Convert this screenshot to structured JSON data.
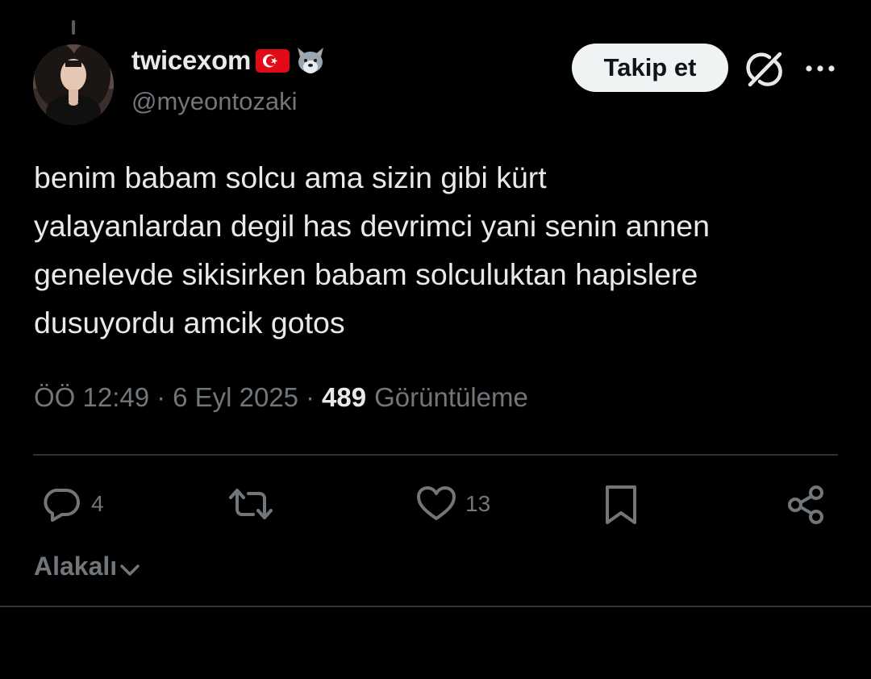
{
  "author": {
    "display_name": "twicexom",
    "handle": "@myeontozaki",
    "badges": [
      "turkey-flag-emoji",
      "wolf-emoji"
    ]
  },
  "header": {
    "follow_label": "Takip et",
    "grok_icon": "grok-icon",
    "more_icon": "more-icon"
  },
  "tweet": {
    "text": "benim babam solcu ama sizin gibi kürt\nyalayanlardan degil has devrimci yani senin annen\ngenelevde sikisirken babam solculuktan hapislere\ndusuyordu amcik gotos",
    "time": "ÖÖ 12:49",
    "date": "6 Eyl 2025",
    "separator": "·",
    "views_count": "489",
    "views_label": "Görüntüleme"
  },
  "actions": {
    "reply_count": "4",
    "repost_count": "",
    "like_count": "13",
    "bookmark_count": "",
    "share_count": ""
  },
  "sort": {
    "label": "Alakalı"
  },
  "colors": {
    "background": "#000000",
    "text_primary": "#e7e9ea",
    "text_secondary": "#71767b",
    "divider": "#2f3336",
    "follow_bg": "#eff3f4",
    "follow_text": "#0f1419"
  }
}
